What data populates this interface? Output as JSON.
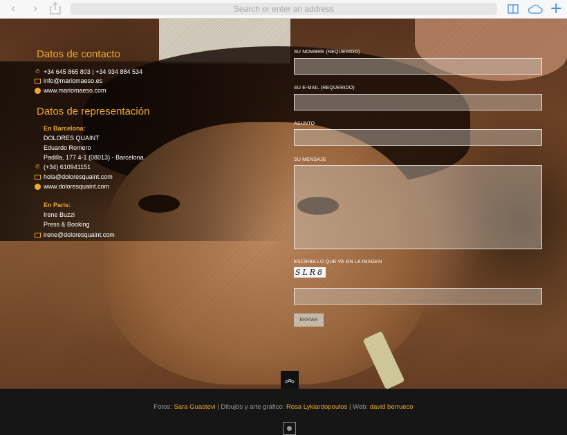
{
  "browser": {
    "address_placeholder": "Search or enter an address",
    "icons": [
      "back-arrow-icon",
      "forward-arrow-icon",
      "share-icon",
      "reading-list-icon",
      "cloud-icon",
      "new-tab-plus-icon"
    ],
    "plus_glyph": "+",
    "back_glyph": "‹",
    "forward_glyph": "›"
  },
  "contact": {
    "title": "Datos de contacto",
    "phone": "+34 645 865 803 | +34 934 884 534",
    "email": "info@mariomaeso.es",
    "web": "www.mariomaeso.com"
  },
  "representation": {
    "title": "Datos de representación",
    "barcelona": {
      "heading": "En Barcelona:",
      "agency": "DOLORES QUAINT",
      "person": "Eduardo Romero",
      "address": "Padilla, 177 4-1 (08013) - Barcelona",
      "phone": "(+34) 610941151",
      "email": "hola@doloresquaint.com",
      "web": "www.doloresquaint.com"
    },
    "paris": {
      "heading": "En Paris:",
      "person": "Irene Buzzi",
      "role": "Press & Booking",
      "email": "irene@doloresquaint.com"
    }
  },
  "form": {
    "name_label": "SU NOMBRE (REQUERIDO)",
    "email_label": "SU E-MAIL (REQUERIDO)",
    "subject_label": "ASUNTO",
    "message_label": "SU MENSAJE",
    "captcha_label": "ESCRIBA LO QUE VE EN LA IMAGEN",
    "captcha_text": "SLR8",
    "send_label": "ENVIAR"
  },
  "back_to_top_glyph": "︽",
  "footer": {
    "fotos_label": "Fotos: ",
    "fotos_name": "Sara Guastevi",
    "sep1": " | Dibujos y arte gráfico: ",
    "dibujos_name": "Rosa Lykiardopoulos",
    "sep2": " | Web: ",
    "web_name": "david berrueco"
  },
  "colors": {
    "accent": "#f0a92a",
    "footer_bg": "#161616",
    "browser_blue": "#3a8ef6"
  }
}
